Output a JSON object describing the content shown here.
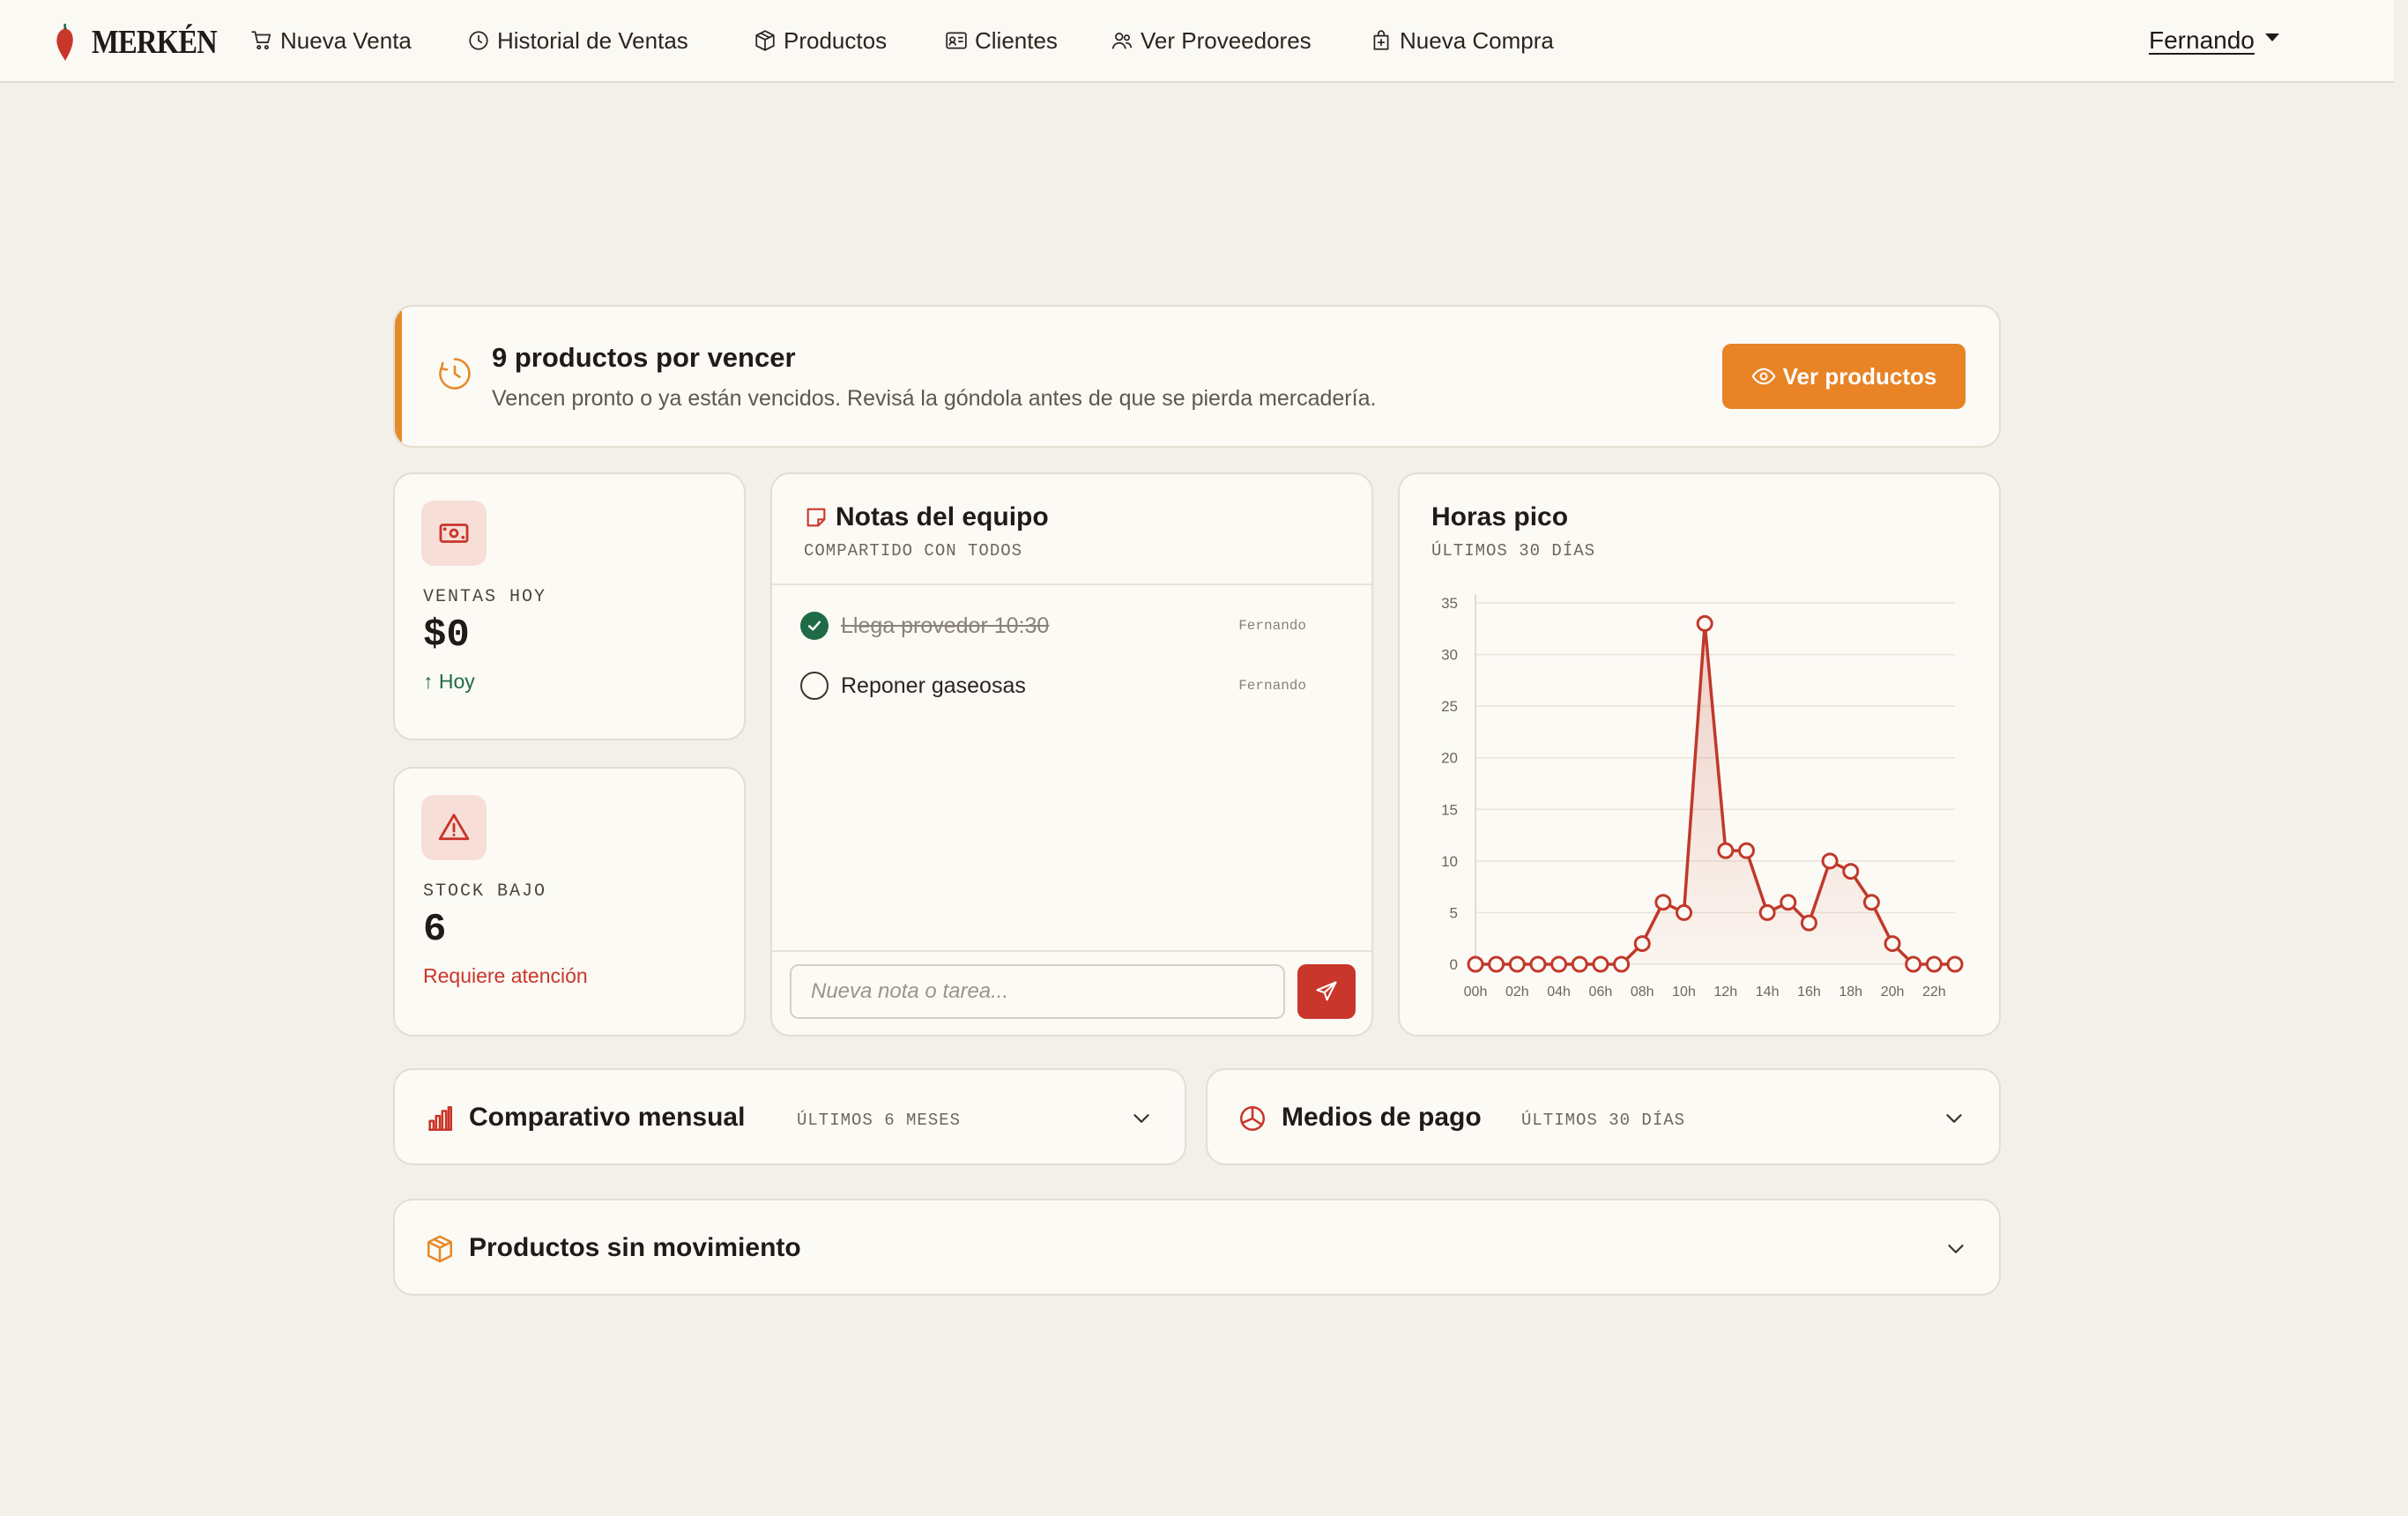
{
  "brand": {
    "name": "MERKÉN"
  },
  "nav": {
    "items": [
      {
        "label": "Nueva Venta",
        "icon": "cart-icon"
      },
      {
        "label": "Historial de Ventas",
        "icon": "clock-icon"
      },
      {
        "label": "Productos",
        "icon": "box-icon"
      },
      {
        "label": "Clientes",
        "icon": "id-card-icon"
      },
      {
        "label": "Ver Proveedores",
        "icon": "users-icon"
      },
      {
        "label": "Nueva Compra",
        "icon": "bag-plus-icon"
      }
    ],
    "user": "Fernando"
  },
  "alert": {
    "title": "9 productos por vencer",
    "text": "Vencen pronto o ya están vencidos. Revisá la góndola antes de que se pierda mercadería.",
    "button": "Ver productos"
  },
  "stats": {
    "sales": {
      "label": "VENTAS HOY",
      "value": "$0",
      "sub": "↑ Hoy",
      "icon": "cash-icon"
    },
    "stock": {
      "label": "STOCK BAJO",
      "value": "6",
      "sub": "Requiere atención",
      "icon": "warning-icon"
    }
  },
  "notes": {
    "title": "Notas del equipo",
    "subtitle": "COMPARTIDO CON TODOS",
    "items": [
      {
        "text": "Llega provedor 10:30",
        "author": "Fernando",
        "done": true
      },
      {
        "text": "Reponer gaseosas",
        "author": "Fernando",
        "done": false
      }
    ],
    "input_placeholder": "Nueva nota o tarea..."
  },
  "peak": {
    "title": "Horas pico",
    "subtitle": "ÚLTIMOS 30 DÍAS"
  },
  "chart_data": {
    "type": "area",
    "title": "Horas pico",
    "x": [
      "00h",
      "01h",
      "02h",
      "03h",
      "04h",
      "05h",
      "06h",
      "07h",
      "08h",
      "09h",
      "10h",
      "11h",
      "12h",
      "13h",
      "14h",
      "15h",
      "16h",
      "17h",
      "18h",
      "19h",
      "20h",
      "21h",
      "22h",
      "23h"
    ],
    "x_tick_labels": [
      "00h",
      "02h",
      "04h",
      "06h",
      "08h",
      "10h",
      "12h",
      "14h",
      "16h",
      "18h",
      "20h",
      "22h"
    ],
    "values": [
      0,
      0,
      0,
      0,
      0,
      0,
      0,
      0,
      2,
      6,
      5,
      33,
      11,
      11,
      5,
      6,
      4,
      10,
      9,
      6,
      2,
      0,
      0,
      0
    ],
    "ylim": [
      0,
      35
    ],
    "y_ticks": [
      0,
      5,
      10,
      15,
      20,
      25,
      30,
      35
    ],
    "grid": true,
    "color": "#c0392b"
  },
  "sections": {
    "monthly": {
      "title": "Comparativo mensual",
      "subtitle": "ÚLTIMOS 6 MESES"
    },
    "payments": {
      "title": "Medios de pago",
      "subtitle": "ÚLTIMOS 30 DÍAS"
    },
    "idle": {
      "title": "Productos sin movimiento"
    }
  },
  "colors": {
    "accent": "#e88326",
    "danger": "#c9362b",
    "success": "#1f6b45",
    "background": "#f3f0ea",
    "card": "#fcfaf5"
  }
}
